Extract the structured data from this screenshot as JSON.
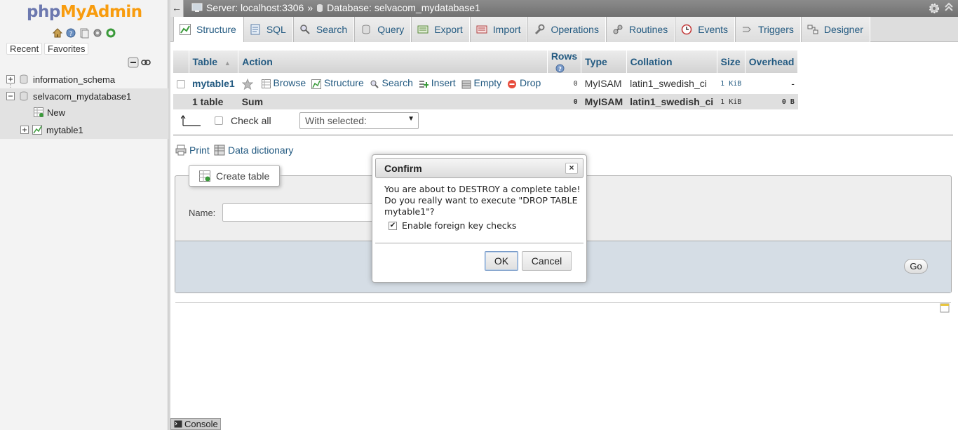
{
  "app": {
    "logo_part1": "php",
    "logo_part2": "MyAdmin"
  },
  "nav": {
    "recent_label": "Recent",
    "favorites_label": "Favorites",
    "tree": [
      {
        "label": "information_schema"
      },
      {
        "label": "selvacom_mydatabase1"
      },
      {
        "label": "New"
      },
      {
        "label": "mytable1"
      }
    ]
  },
  "topbar": {
    "back_label": "←",
    "server": "Server: localhost:3306",
    "separator": "»",
    "database": "Database: selvacom_mydatabase1"
  },
  "tabs": [
    {
      "label": "Structure",
      "icon": "structure-icon",
      "active": true
    },
    {
      "label": "SQL",
      "icon": "sql-icon"
    },
    {
      "label": "Search",
      "icon": "search-icon"
    },
    {
      "label": "Query",
      "icon": "query-icon"
    },
    {
      "label": "Export",
      "icon": "export-icon"
    },
    {
      "label": "Import",
      "icon": "import-icon"
    },
    {
      "label": "Operations",
      "icon": "wrench-icon"
    },
    {
      "label": "Routines",
      "icon": "routines-icon"
    },
    {
      "label": "Events",
      "icon": "clock-icon"
    },
    {
      "label": "Triggers",
      "icon": "triggers-icon"
    },
    {
      "label": "Designer",
      "icon": "designer-icon"
    }
  ],
  "table": {
    "headers": {
      "table": "Table",
      "sort_arrow": "▲",
      "action": "Action",
      "rows": "Rows",
      "type": "Type",
      "collation": "Collation",
      "size": "Size",
      "overhead": "Overhead"
    },
    "row": {
      "name": "mytable1",
      "actions": {
        "browse": "Browse",
        "structure": "Structure",
        "search": "Search",
        "insert": "Insert",
        "empty": "Empty",
        "drop": "Drop"
      },
      "rows": "0",
      "type": "MyISAM",
      "collation": "latin1_swedish_ci",
      "size": "1 KiB",
      "overhead": "-"
    },
    "sum": {
      "count": "1 table",
      "label": "Sum",
      "rows": "0",
      "type": "MyISAM",
      "collation": "latin1_swedish_ci",
      "size": "1 KiB",
      "overhead": "0 B"
    }
  },
  "controls": {
    "check_all": "Check all",
    "with_selected": "With selected:",
    "print": "Print",
    "data_dictionary": "Data dictionary"
  },
  "create": {
    "legend": "Create table",
    "name_label": "Name:",
    "go": "Go"
  },
  "console": {
    "label": "Console"
  },
  "dialog": {
    "title": "Confirm",
    "close": "×",
    "message": "You are about to DESTROY a complete table! Do you really want to execute \"DROP TABLE mytable1\"?",
    "fk_label": "Enable foreign key checks",
    "fk_checked": true,
    "ok": "OK",
    "cancel": "Cancel"
  },
  "colors": {
    "link": "#235a81",
    "logo_blue": "#6c78af",
    "logo_orange": "#f89c0e",
    "drop_red": "#e74c3c"
  }
}
